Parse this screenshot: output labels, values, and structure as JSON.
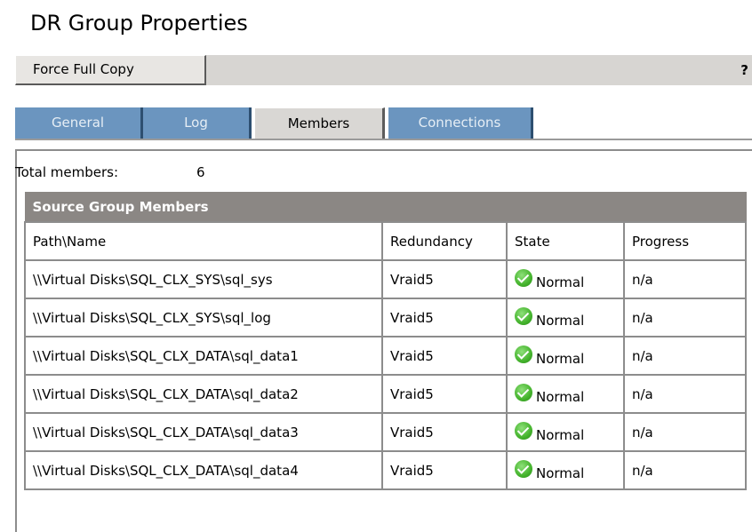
{
  "page": {
    "title": "DR Group Properties"
  },
  "toolbar": {
    "force_full_copy_label": "Force Full Copy",
    "help_label": "?"
  },
  "tabs": [
    {
      "label": "General",
      "active": false
    },
    {
      "label": "Log",
      "active": false
    },
    {
      "label": "Members",
      "active": true
    },
    {
      "label": "Connections",
      "active": false
    }
  ],
  "members": {
    "total_label": "Total members:",
    "total_value": "6",
    "section_title": "Source Group Members",
    "columns": [
      "Path\\Name",
      "Redundancy",
      "State",
      "Progress"
    ],
    "rows": [
      {
        "path": "\\\\Virtual Disks\\SQL_CLX_SYS\\sql_sys",
        "redundancy": "Vraid5",
        "state": "Normal",
        "state_icon": "check-circle-icon",
        "progress": "n/a"
      },
      {
        "path": "\\\\Virtual Disks\\SQL_CLX_SYS\\sql_log",
        "redundancy": "Vraid5",
        "state": "Normal",
        "state_icon": "check-circle-icon",
        "progress": "n/a"
      },
      {
        "path": "\\\\Virtual Disks\\SQL_CLX_DATA\\sql_data1",
        "redundancy": "Vraid5",
        "state": "Normal",
        "state_icon": "check-circle-icon",
        "progress": "n/a"
      },
      {
        "path": "\\\\Virtual Disks\\SQL_CLX_DATA\\sql_data2",
        "redundancy": "Vraid5",
        "state": "Normal",
        "state_icon": "check-circle-icon",
        "progress": "n/a"
      },
      {
        "path": "\\\\Virtual Disks\\SQL_CLX_DATA\\sql_data3",
        "redundancy": "Vraid5",
        "state": "Normal",
        "state_icon": "check-circle-icon",
        "progress": "n/a"
      },
      {
        "path": "\\\\Virtual Disks\\SQL_CLX_DATA\\sql_data4",
        "redundancy": "Vraid5",
        "state": "Normal",
        "state_icon": "check-circle-icon",
        "progress": "n/a"
      }
    ]
  },
  "colors": {
    "tab_inactive": "#6b95bf",
    "tab_active": "#d9d7d4",
    "section_header": "#8b8784",
    "status_ok": "#44b32c"
  }
}
